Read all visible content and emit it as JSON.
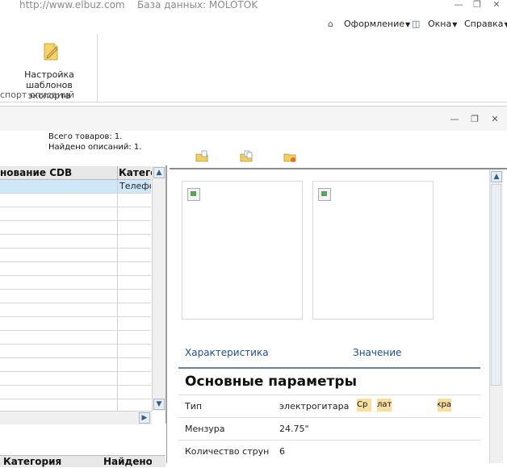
{
  "titlebar": {
    "url": "http://www.elbuz.com",
    "database": "База данных: MOLOTOK"
  },
  "menubar": {
    "items": [
      {
        "label": "Оформление"
      },
      {
        "label": "Окна"
      },
      {
        "label": "Справка"
      }
    ]
  },
  "ribbon": {
    "button_line1": "Настройка",
    "button_line2": "шаблонов экспорта",
    "group_caption": "спорт описаний"
  },
  "info": {
    "total_goods": "Всего товаров: 1.",
    "found_descriptions": "Найдено описаний: 1."
  },
  "grid": {
    "columns": [
      "нование CDB",
      "Катего"
    ],
    "selected_cell": "Телефо"
  },
  "grid2": {
    "columns": [
      "Категория",
      "Найдено"
    ]
  },
  "preview": {
    "characteristic_header": "Характеристика",
    "value_header": "Значение",
    "section_title": "Основные параметры",
    "rows": [
      {
        "label": "Тип",
        "value": "электрогитара"
      },
      {
        "label": "Мензура",
        "value": "24.75\""
      },
      {
        "label": "Количество струн",
        "value": "6"
      }
    ],
    "chips": [
      "Ср",
      "лат",
      "кра"
    ]
  },
  "colors": {
    "link_blue": "#1f4e8c",
    "selection": "#cfe8f8",
    "chip": "#f6dfa0"
  }
}
